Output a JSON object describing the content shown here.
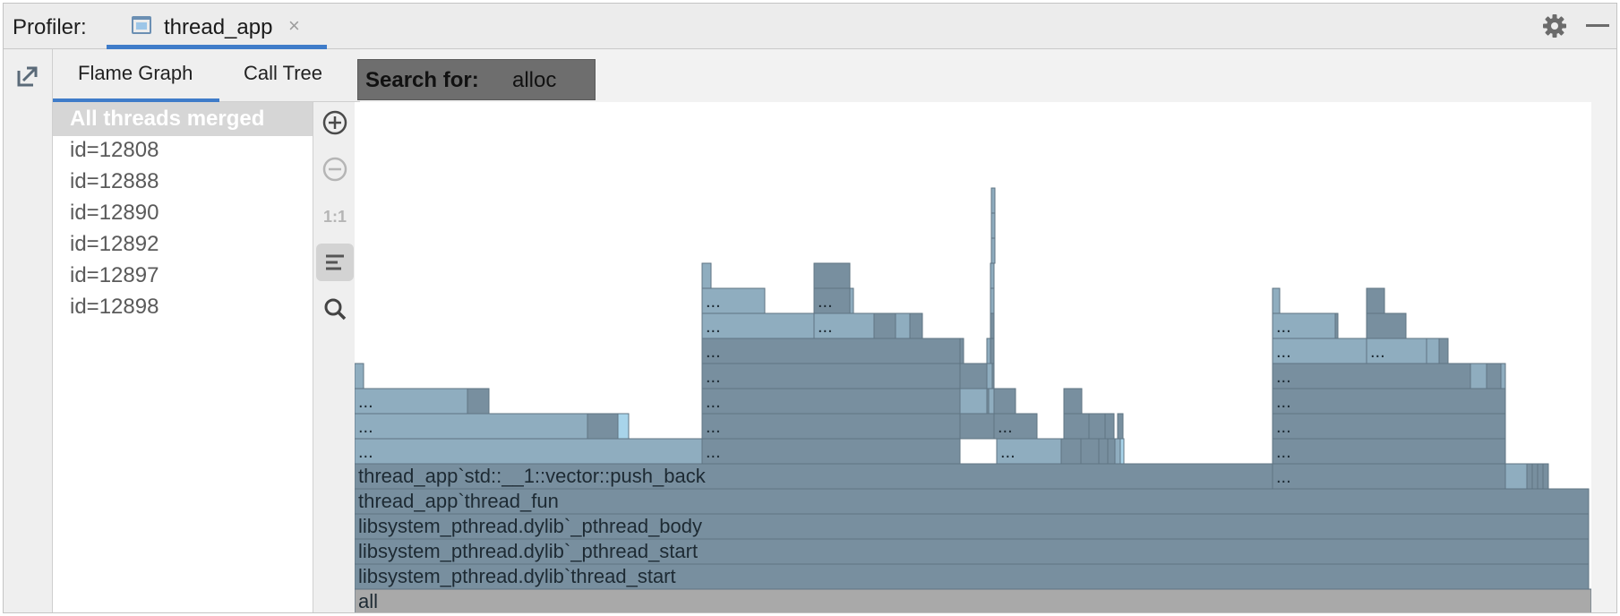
{
  "header": {
    "profiler_label": "Profiler:",
    "tab_title": "thread_app",
    "tab_close": "×",
    "accent_color": "#3f7cc9"
  },
  "view_tabs": [
    {
      "label": "Flame Graph",
      "selected": true
    },
    {
      "label": "Call Tree",
      "selected": false
    }
  ],
  "search": {
    "label": "Search for:",
    "value": "alloc"
  },
  "threads": [
    {
      "label": "All threads merged",
      "selected": true
    },
    {
      "label": "id=12808",
      "selected": false
    },
    {
      "label": "id=12888",
      "selected": false
    },
    {
      "label": "id=12890",
      "selected": false
    },
    {
      "label": "id=12892",
      "selected": false
    },
    {
      "label": "id=12897",
      "selected": false
    },
    {
      "label": "id=12898",
      "selected": false
    }
  ],
  "toolbar": {
    "icons": [
      "zoom-in-icon",
      "zoom-out-icon",
      "reset-zoom-icon",
      "align-left-icon",
      "search-icon"
    ],
    "reset_zoom_label": "1:1"
  },
  "flame_graph": {
    "colors": {
      "frame": "#788f9f",
      "highlight": "#8fadbf",
      "match": "#a8d4ea",
      "root": "#a9a9a9"
    },
    "frames_bottom_up": [
      {
        "label": "all"
      },
      {
        "label": "libsystem_pthread.dylib`thread_start"
      },
      {
        "label": "libsystem_pthread.dylib`_pthread_start"
      },
      {
        "label": "libsystem_pthread.dylib`_pthread_body"
      },
      {
        "label": "thread_app`thread_fun"
      },
      {
        "label": "thread_app`std::__1::vector::push_back"
      }
    ],
    "ellipsis": "..."
  }
}
